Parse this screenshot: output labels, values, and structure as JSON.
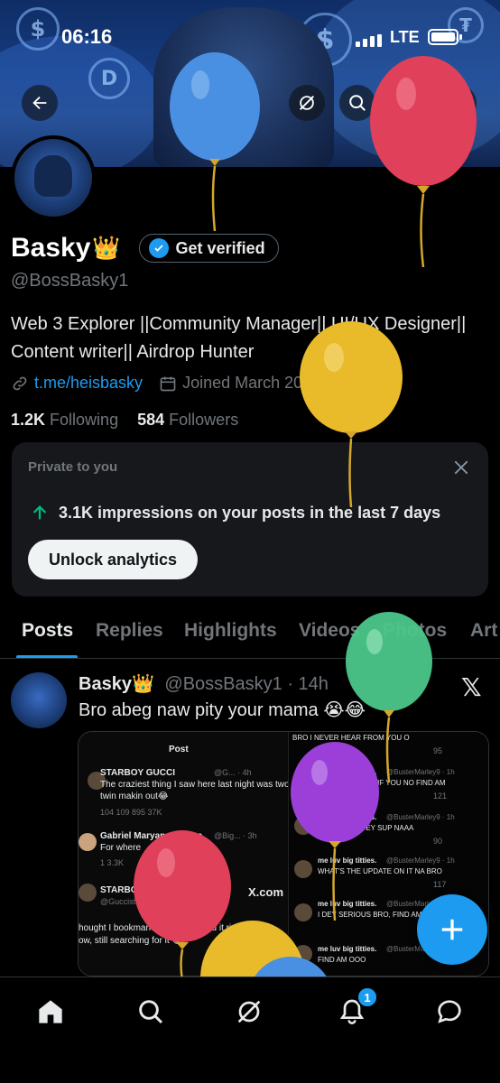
{
  "status_bar": {
    "time": "06:16",
    "network": "LTE"
  },
  "profile": {
    "name": "Basky",
    "crown": "👑",
    "get_verified_label": "Get verified",
    "handle": "@BossBasky1",
    "bio_line1": "Web 3 Explorer ||Community Manager|| UI/UX Designer||",
    "bio_line2": "Content writer|| Airdrop Hunter",
    "link": "t.me/heisbasky",
    "joined": "Joined March 2021",
    "following_count": "1.2K",
    "following_label": "Following",
    "followers_count": "584",
    "followers_label": "Followers"
  },
  "analytics_card": {
    "title": "Private to you",
    "impressions_text": "3.1K impressions on your posts in the last 7 days",
    "unlock_label": "Unlock analytics"
  },
  "tabs": [
    "Posts",
    "Replies",
    "Highlights",
    "Videos",
    "Photos",
    "Art"
  ],
  "post": {
    "name": "Basky",
    "crown": "👑",
    "handle_time": "@BossBasky1 · 14h",
    "text": "Bro abeg naw pity your mama 😭😂",
    "media": {
      "header": "Post",
      "t1_name": "STARBOY GUCCI",
      "t1_handle": "@G... · 4h",
      "t1_text1": "The craziest thing I saw here last night was two",
      "t1_text2": "twin makin out😂",
      "t1_stats": "104   109   895   37K",
      "t2_name": "Gabriel Maryann Ifeoma",
      "t2_handle": "@Big... · 3h",
      "t2_text": "For where",
      "t2_stats": "1   3.3K",
      "t3_name": "STARBOY GUCCI",
      "t3_handle": "@Guccistarboi",
      "t3_text1": "hought I bookmarked but can't find it right",
      "t3_text2": "ow, still searching for it 😂",
      "xcom": "X.com",
      "r_top": "BRO I NEVER HEAR FROM YOU O",
      "r_name": "me luv big titties.",
      "r_handle": "@BusterMarley9 · 1h",
      "r1_text": "E NO GO FUNNY IF YOU NO FIND AM",
      "r2_text": "BRO WETIN DEY SUP NAAA",
      "r3_text": "WHAT'S THE UPDATE ON IT NA BRO",
      "r4_text": "I DEY SERIOUS BRO, FIND AM",
      "r5_text": "FIND AM OOO",
      "r_stats1": "95",
      "r_stats2": "121",
      "r_stats3": "90",
      "r_stats4": "117"
    }
  },
  "notifications_badge": "1"
}
